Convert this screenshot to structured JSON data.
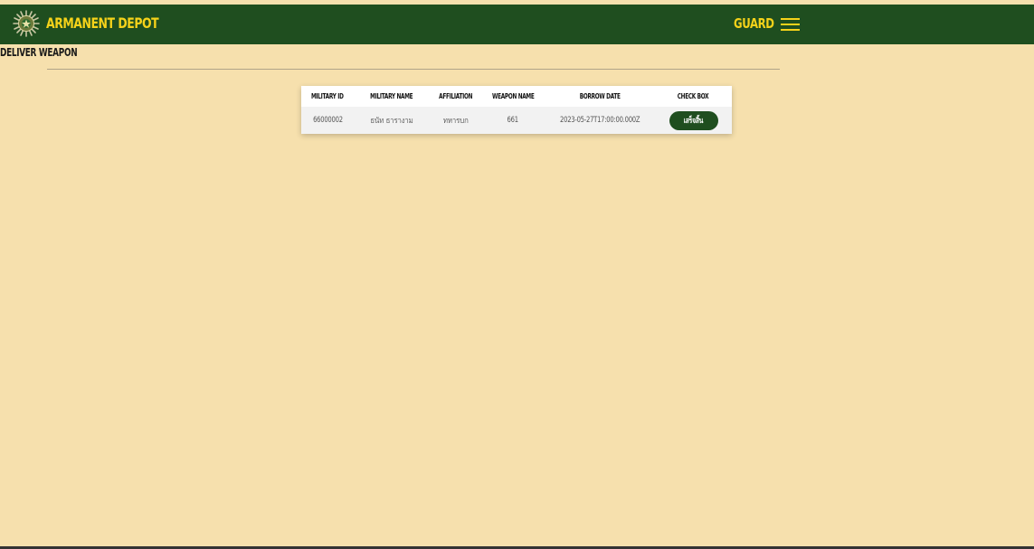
{
  "colors": {
    "navbar_bg": "#1f4e1f",
    "brand_text": "#f5d21a",
    "page_bg": "#f6e0ad",
    "button_bg": "#1f4e1f",
    "button_text": "#ffffff"
  },
  "header": {
    "brand": "ARMANENT DEPOT",
    "logo_icon": "military-emblem-icon",
    "role_label": "GUARD",
    "menu_icon": "hamburger-menu-icon"
  },
  "page": {
    "title": "DELIVER WEAPON"
  },
  "table": {
    "columns": [
      "MILITARY ID",
      "MILITARY NAME",
      "AFFILIATION",
      "WEAPON NAME",
      "BORROW DATE",
      "CHECK BOX"
    ],
    "rows": [
      {
        "military_id": "66000002",
        "military_name": "ธนัท ธารางาม",
        "affiliation": "ทหารบก",
        "weapon_name": "661",
        "borrow_date": "2023-05-27T17:00:00.000Z",
        "action_label": "เสร็จสิ้น"
      }
    ]
  }
}
